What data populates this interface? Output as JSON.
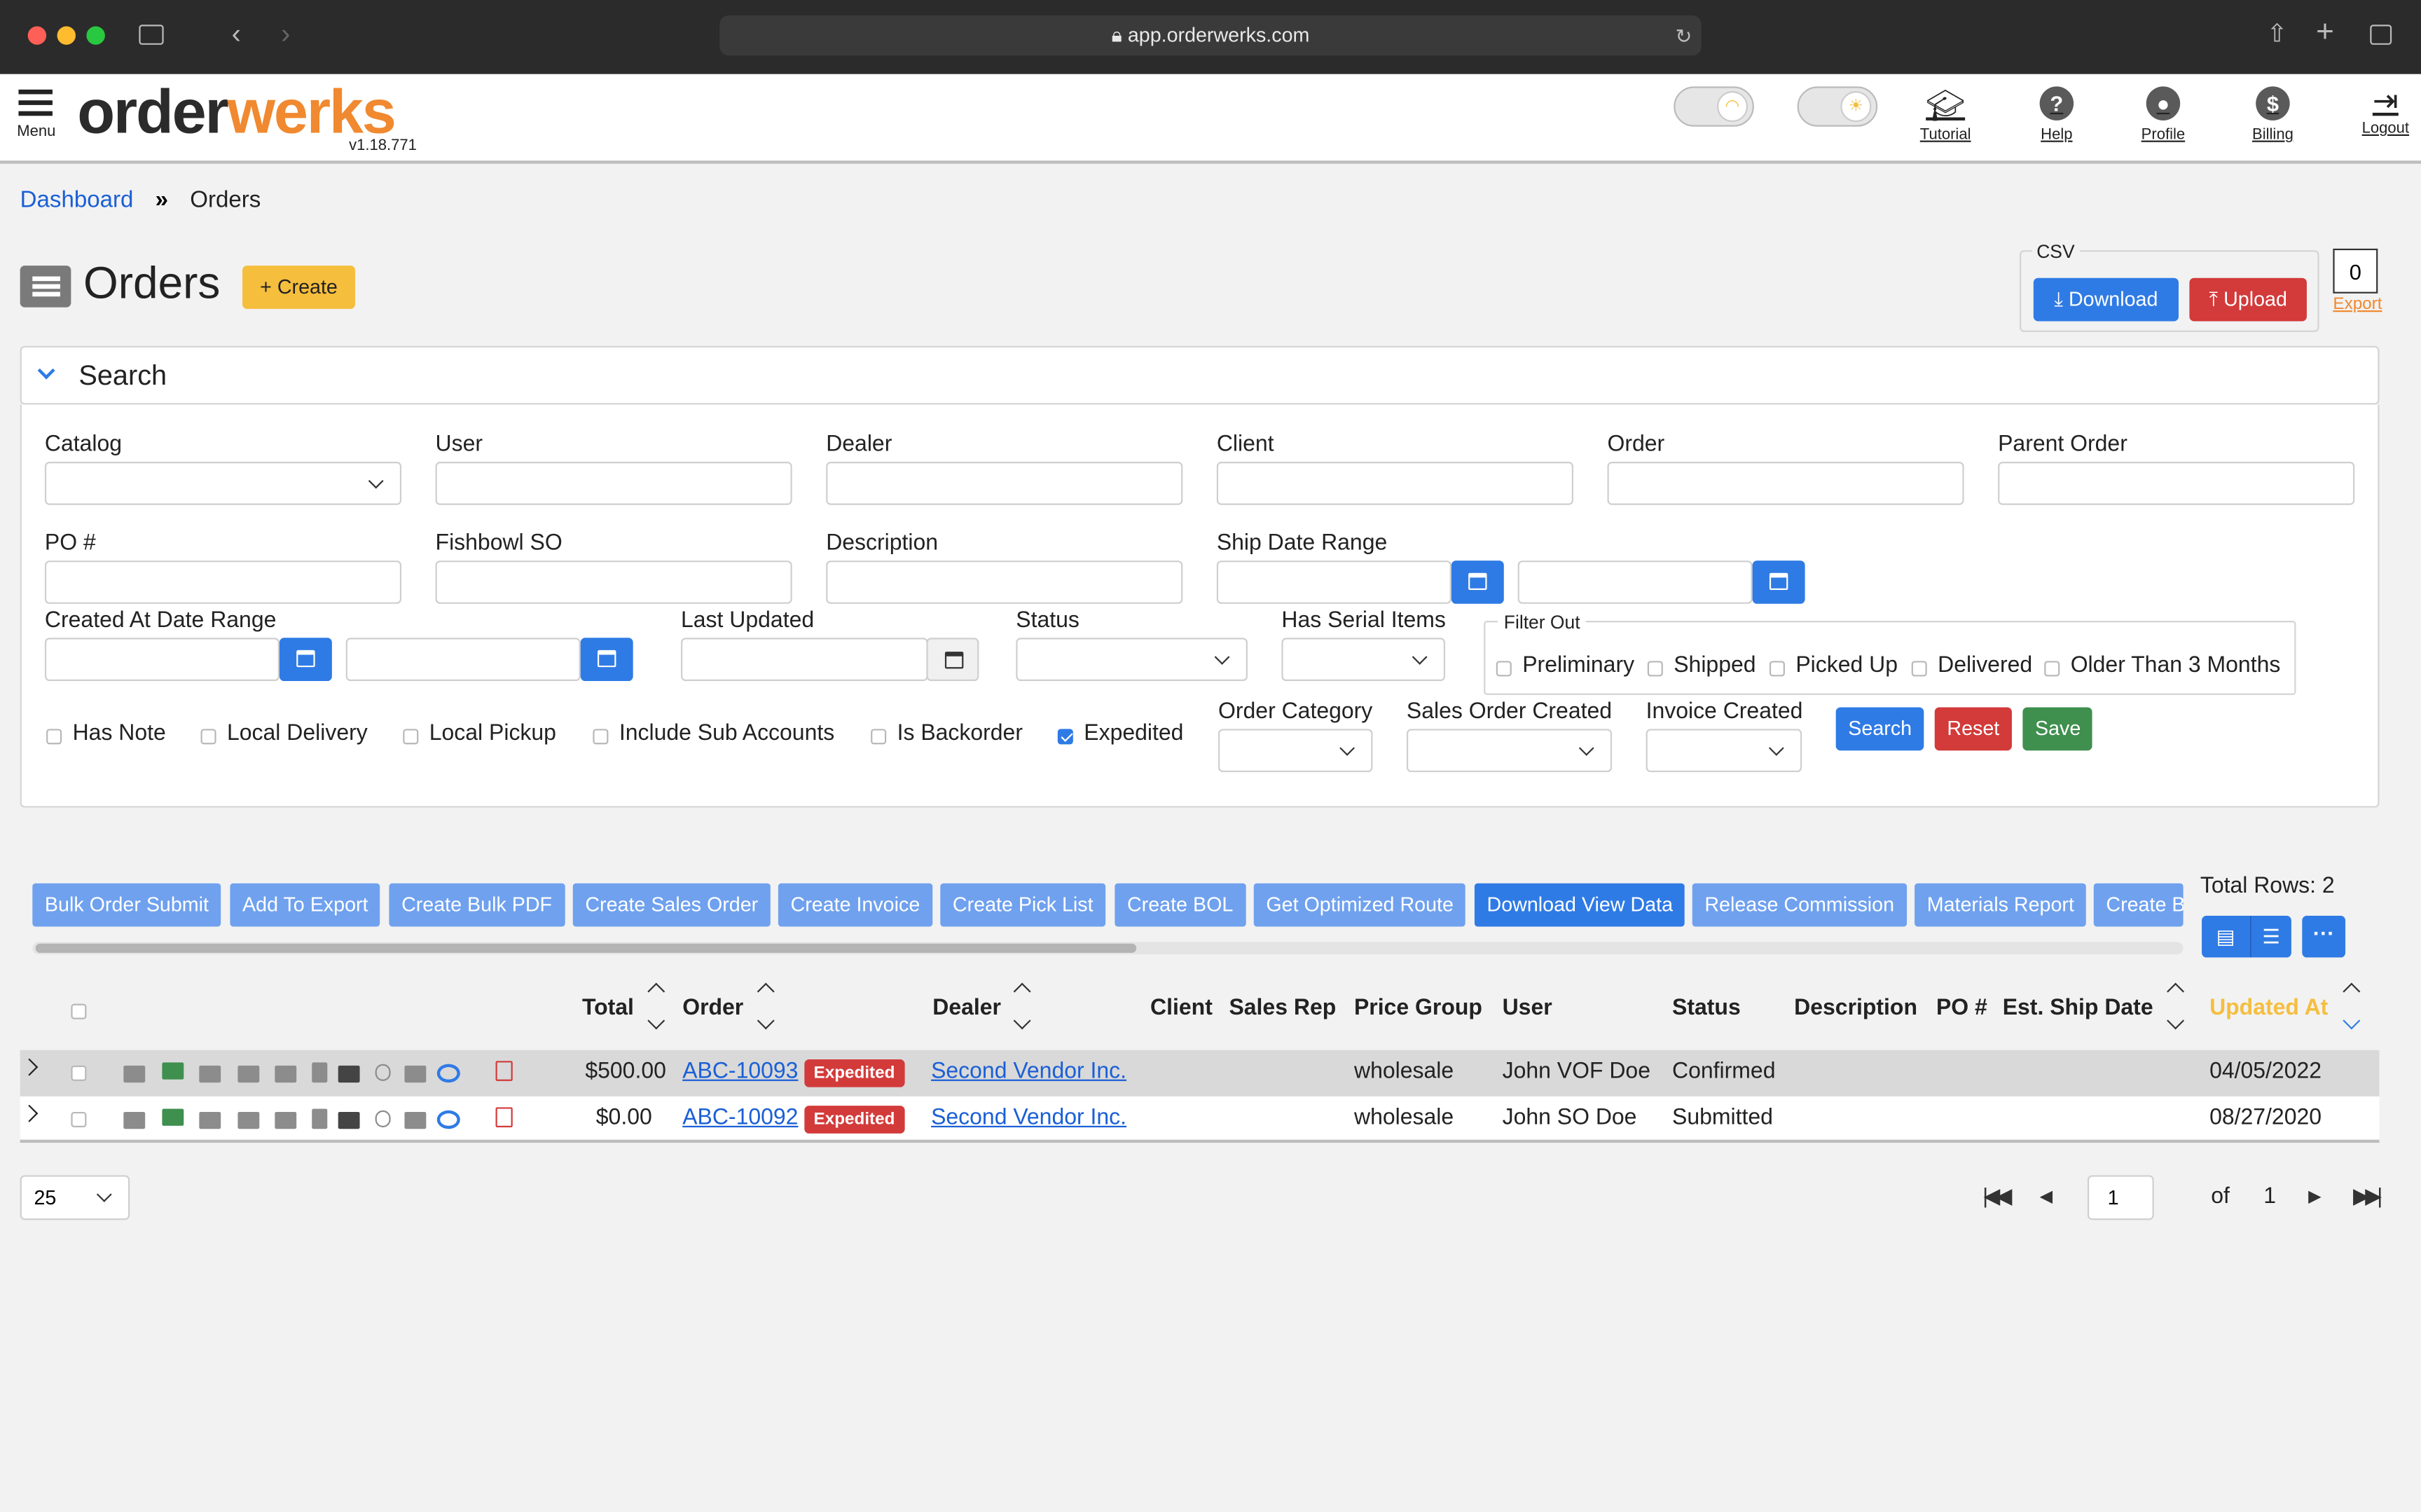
{
  "browser": {
    "url": "app.orderwerks.com"
  },
  "header": {
    "menu_label": "Menu",
    "logo_dark": "order",
    "logo_orange": "werks",
    "version": "v1.18.771",
    "nav": {
      "tutorial": "Tutorial",
      "help": "Help",
      "profile": "Profile",
      "billing": "Billing",
      "logout": "Logout"
    }
  },
  "breadcrumb": {
    "home": "Dashboard",
    "current": "Orders"
  },
  "page": {
    "title": "Orders",
    "create_label": "Create"
  },
  "csv": {
    "legend": "CSV",
    "download_label": "Download",
    "upload_label": "Upload",
    "export_count": "0",
    "export_label": "Export"
  },
  "search": {
    "title": "Search",
    "labels": {
      "catalog": "Catalog",
      "user": "User",
      "dealer": "Dealer",
      "client": "Client",
      "order": "Order",
      "parent_order": "Parent Order",
      "po": "PO #",
      "fishbowl_so": "Fishbowl SO",
      "description": "Description",
      "ship_date_range": "Ship Date Range",
      "created_at_range": "Created At Date Range",
      "last_updated": "Last Updated",
      "status": "Status",
      "has_serial_items": "Has Serial Items",
      "order_category": "Order Category",
      "sales_order_created": "Sales Order Created",
      "invoice_created": "Invoice Created"
    },
    "filter_out": {
      "legend": "Filter Out",
      "options": [
        "Preliminary",
        "Shipped",
        "Picked Up",
        "Delivered",
        "Older Than 3 Months"
      ]
    },
    "checkboxes": [
      {
        "label": "Has Note",
        "checked": false
      },
      {
        "label": "Local Delivery",
        "checked": false
      },
      {
        "label": "Local Pickup",
        "checked": false
      },
      {
        "label": "Include Sub Accounts",
        "checked": false
      },
      {
        "label": "Is Backorder",
        "checked": false
      },
      {
        "label": "Expedited",
        "checked": true
      }
    ],
    "buttons": {
      "search": "Search",
      "reset": "Reset",
      "save": "Save"
    }
  },
  "actions": [
    "Bulk Order Submit",
    "Add To Export",
    "Create Bulk PDF",
    "Create Sales Order",
    "Create Invoice",
    "Create Pick List",
    "Create BOL",
    "Get Optimized Route",
    "Download View Data",
    "Release Commission",
    "Materials Report",
    "Create B"
  ],
  "total_rows_label": "Total Rows:",
  "total_rows": "2",
  "table": {
    "headers": {
      "total": "Total",
      "order": "Order",
      "dealer": "Dealer",
      "client": "Client",
      "sales_rep": "Sales Rep",
      "price_group": "Price Group",
      "user": "User",
      "status": "Status",
      "description": "Description",
      "po": "PO #",
      "est_ship_date": "Est. Ship Date",
      "updated_at": "Updated At"
    },
    "rows": [
      {
        "total": "$500.00",
        "order": "ABC-10093",
        "badge": "Expedited",
        "dealer": "Second Vendor Inc.",
        "price_group": "wholesale",
        "user": "John VOF Doe",
        "status": "Confirmed",
        "updated_at": "04/05/2022"
      },
      {
        "total": "$0.00",
        "order": "ABC-10092",
        "badge": "Expedited",
        "dealer": "Second Vendor Inc.",
        "price_group": "wholesale",
        "user": "John SO Doe",
        "status": "Submitted",
        "updated_at": "08/27/2020"
      }
    ]
  },
  "pagination": {
    "per_page": "25",
    "page": "1",
    "of_label": "of",
    "total_pages": "1"
  },
  "colors": {
    "primary": "#2f7be5",
    "danger": "#d33a3a",
    "success": "#3f8f4f",
    "warning": "#f5be3d",
    "brand_orange": "#f0892f",
    "action": "#6fa1ee"
  }
}
